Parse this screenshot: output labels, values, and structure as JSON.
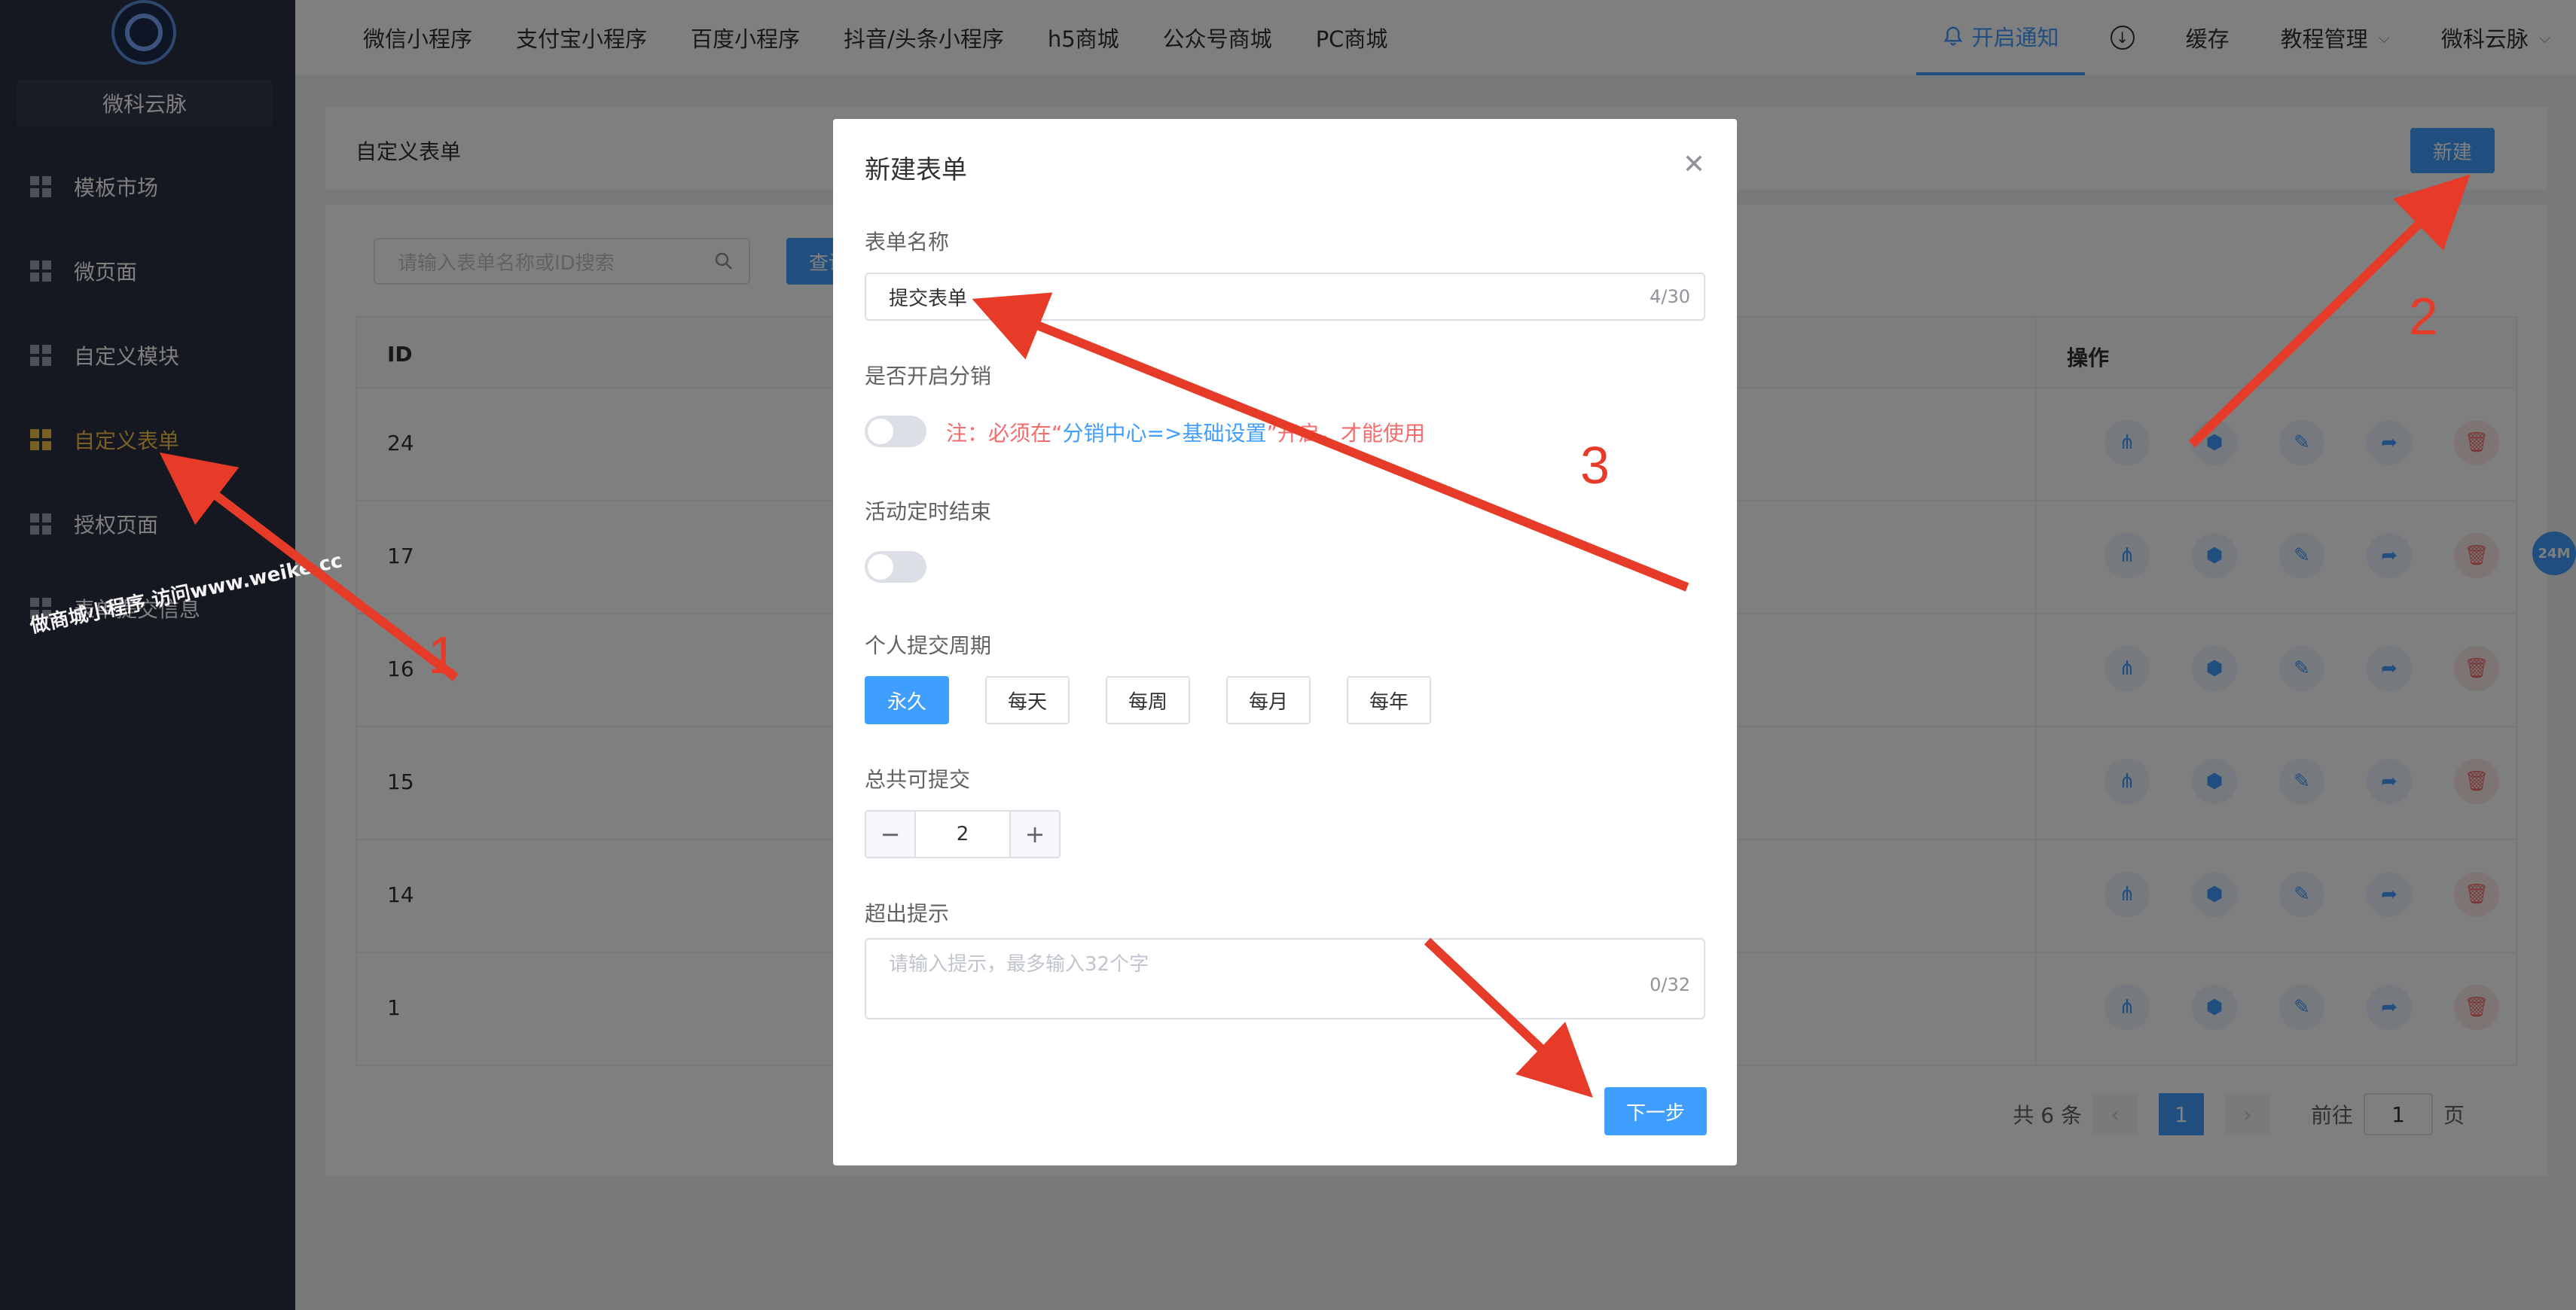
{
  "sidebar": {
    "brand": "微科云脉",
    "items": [
      {
        "label": "模板市场"
      },
      {
        "label": "微页面"
      },
      {
        "label": "自定义模块"
      },
      {
        "label": "自定义表单"
      },
      {
        "label": "授权页面"
      },
      {
        "label": "表单提交信息"
      }
    ],
    "watermark": "做商城小程序 访问www.weike.cc"
  },
  "topbar": {
    "tabs": [
      "微信小程序",
      "支付宝小程序",
      "百度小程序",
      "抖音/头条小程序",
      "h5商城",
      "公众号商城",
      "PC商城"
    ],
    "notify": "开启通知",
    "cache": "缓存",
    "tutorial": "教程管理",
    "user": "微科云脉"
  },
  "page": {
    "title": "自定义表单",
    "new_button": "新建",
    "search_placeholder": "请输入表单名称或ID搜索",
    "query_button": "查询",
    "col_id": "ID",
    "col_ops": "操作",
    "rows": [
      {
        "id": "24"
      },
      {
        "id": "17"
      },
      {
        "id": "16"
      },
      {
        "id": "15"
      },
      {
        "id": "14"
      },
      {
        "id": "1"
      }
    ],
    "pager": {
      "total": "共 6 条",
      "current": "1",
      "goto_prefix": "前往",
      "goto_value": "1",
      "goto_suffix": "页"
    },
    "floating_badge": "24M"
  },
  "dialog": {
    "title": "新建表单",
    "name_label": "表单名称",
    "name_value": "提交表单",
    "name_counter": "4/30",
    "distribution_label": "是否开启分销",
    "note_prefix": "注：必须在“",
    "note_link": "分销中心=>基础设置",
    "note_suffix": "”开启，才能使用",
    "timed_end_label": "活动定时结束",
    "period_label": "个人提交周期",
    "periods": [
      "永久",
      "每天",
      "每周",
      "每月",
      "每年"
    ],
    "total_label": "总共可提交",
    "total_value": "2",
    "overflow_label": "超出提示",
    "overflow_placeholder": "请输入提示，最多输入32个字",
    "overflow_counter": "0/32",
    "next_button": "下一步"
  },
  "annotations": {
    "n1": "1",
    "n2": "2",
    "n3": "3"
  },
  "colors": {
    "primary": "#409eff",
    "sidebar_bg": "#2b3140",
    "active": "#f3c14b",
    "arrow": "#e63b28",
    "danger": "#f56c6c"
  }
}
